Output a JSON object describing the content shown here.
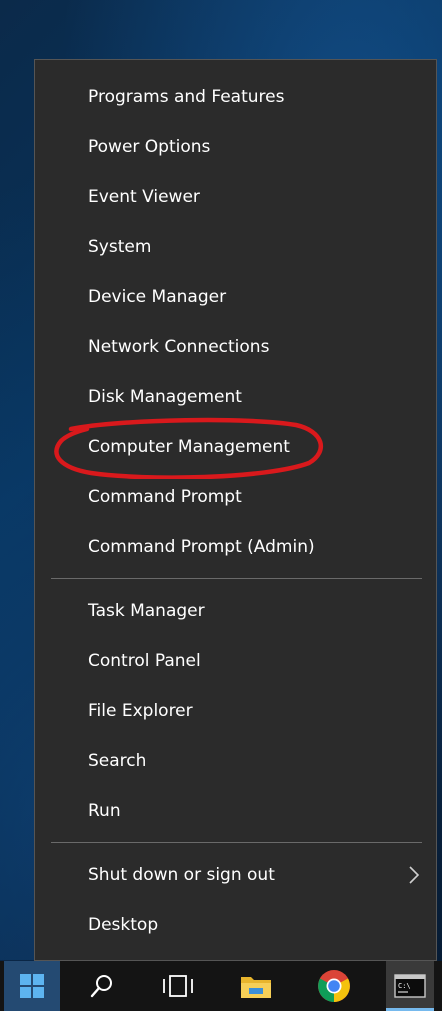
{
  "context_menu": {
    "group1": [
      {
        "label": "Programs and Features"
      },
      {
        "label": "Power Options"
      },
      {
        "label": "Event Viewer"
      },
      {
        "label": "System"
      },
      {
        "label": "Device Manager"
      },
      {
        "label": "Network Connections"
      },
      {
        "label": "Disk Management"
      },
      {
        "label": "Computer Management"
      },
      {
        "label": "Command Prompt"
      },
      {
        "label": "Command Prompt (Admin)"
      }
    ],
    "group2": [
      {
        "label": "Task Manager"
      },
      {
        "label": "Control Panel"
      },
      {
        "label": "File Explorer"
      },
      {
        "label": "Search"
      },
      {
        "label": "Run"
      }
    ],
    "group3": [
      {
        "label": "Shut down or sign out",
        "has_submenu": true
      },
      {
        "label": "Desktop"
      }
    ],
    "highlight_color": "#d9191c"
  },
  "taskbar": {
    "buttons": [
      {
        "icon": "windows-start-icon"
      },
      {
        "icon": "search-icon"
      },
      {
        "icon": "task-view-icon"
      },
      {
        "icon": "file-explorer-icon"
      },
      {
        "icon": "chrome-icon"
      },
      {
        "icon": "command-prompt-icon"
      }
    ],
    "accent_color": "#76b9ed"
  }
}
